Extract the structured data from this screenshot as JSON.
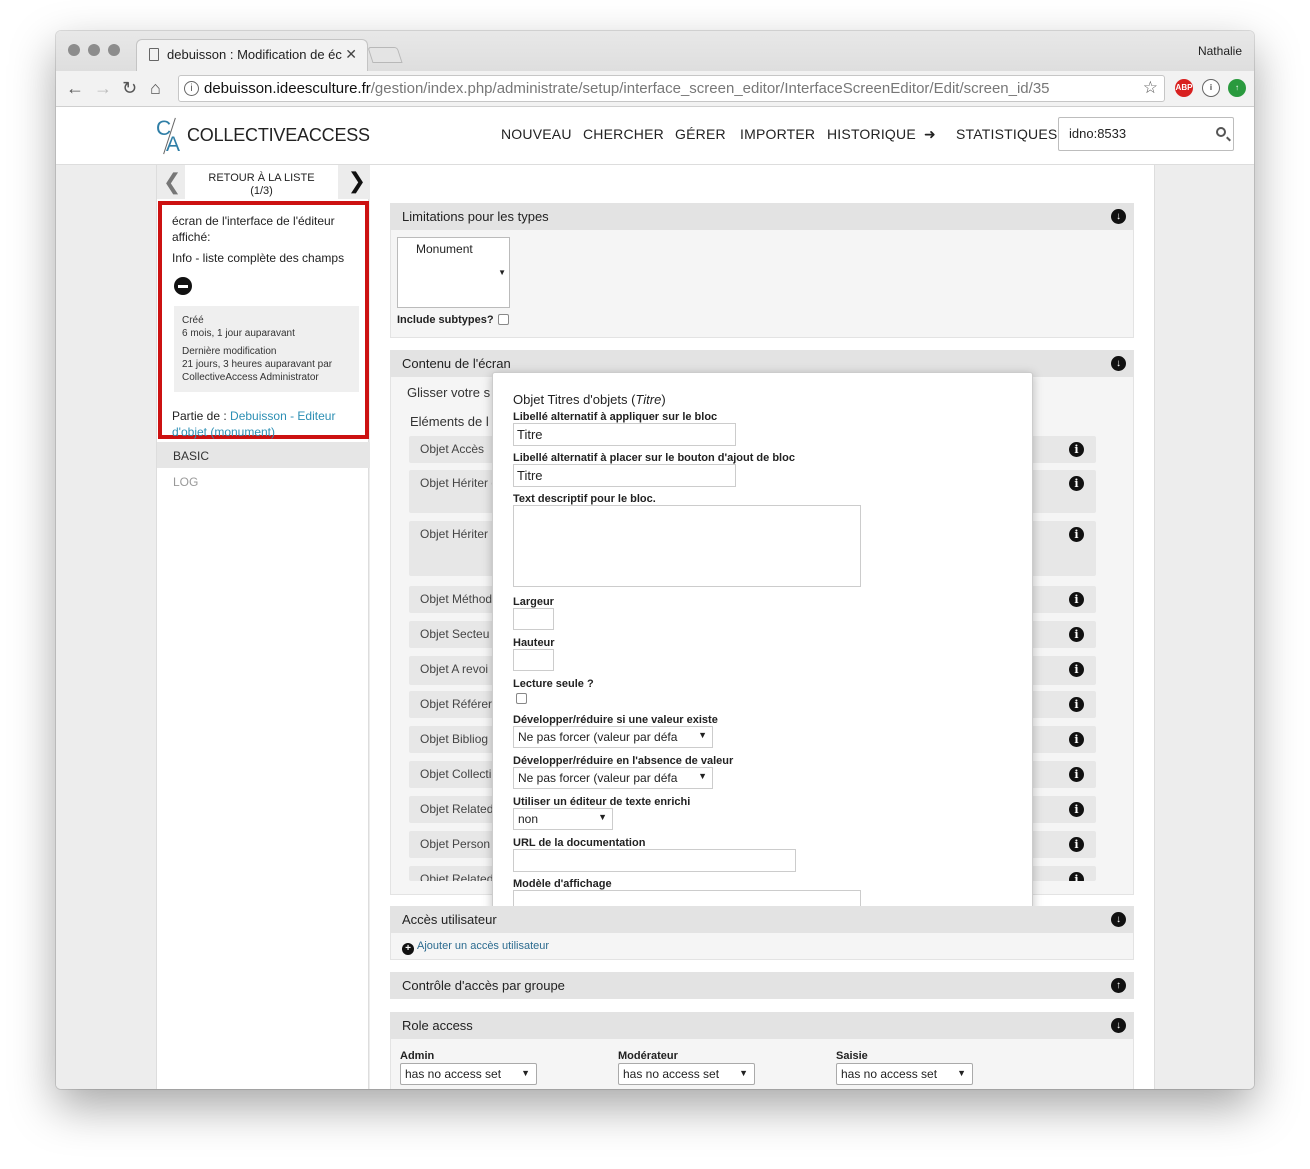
{
  "browser": {
    "tab_title": "debuisson : Modification de éc",
    "tab_close": "✕",
    "profile": "Nathalie",
    "url_host": "debuisson.ideesculture.fr",
    "url_path": "/gestion/index.php/administrate/setup/interface_screen_editor/InterfaceScreenEditor/Edit/screen_id/35",
    "ext_abp": "ABP"
  },
  "app": {
    "logo_text": "COLLECTIVEACCESS",
    "logo_c": "C",
    "logo_a": "A",
    "menu": [
      "NOUVEAU",
      "CHERCHER",
      "GÉRER",
      "IMPORTER",
      "HISTORIQUE",
      "➜",
      "STATISTIQUES"
    ],
    "search_value": "idno:8533"
  },
  "sidebar": {
    "back_label": "RETOUR À LA LISTE",
    "back_count": "(1/3)",
    "screen_label": "écran de l'interface de l'éditeur affiché:",
    "screen_name": "Info - liste complète des champs",
    "created_label": "Créé",
    "created_value": "6 mois, 1 jour auparavant",
    "modified_label": "Dernière modification",
    "modified_value": "21 jours, 3 heures auparavant par CollectiveAccess Administrator",
    "part_of_label": "Partie de :",
    "part_of_link": "Debuisson - Editeur d'objet (monument)",
    "basic": "BASIC",
    "log": "LOG"
  },
  "type_restrictions": {
    "title": "Limitations pour les types",
    "selected": "Monument",
    "include_subtypes": "Include subtypes?"
  },
  "screen_content": {
    "title": "Contenu de l'écran",
    "drag_hint": "Glisser votre s",
    "elements_label": "Eléments de l",
    "items": [
      {
        "label": "Objet Accès"
      },
      {
        "label": "Objet Hériter des collection"
      },
      {
        "label": "Objet Hériter individuel de de l'objet par"
      },
      {
        "label": "Objet Méthod"
      },
      {
        "label": "Objet Secteu"
      },
      {
        "label": "Objet A revoi"
      },
      {
        "label": "Objet Référer"
      },
      {
        "label": "Objet Bibliog"
      },
      {
        "label": "Objet Collecti"
      },
      {
        "label": "Objet Related"
      },
      {
        "label": "Objet Person"
      },
      {
        "label": "Objet Related"
      }
    ],
    "info_glyph": "i"
  },
  "popup": {
    "title_prefix": "Objet Titres d'objets (",
    "title_italic": "Titre",
    "title_suffix": ")",
    "alt_label_label": "Libellé alternatif à appliquer sur le bloc",
    "alt_label_value": "Titre",
    "add_button_label": "Libellé alternatif à placer sur le bouton d'ajout de bloc",
    "add_button_value": "Titre",
    "description_label": "Text descriptif pour le bloc.",
    "width_label": "Largeur",
    "height_label": "Hauteur",
    "readonly_label": "Lecture seule ?",
    "collapse_if_value_label": "Développer/réduire si une valeur existe",
    "collapse_if_value_value": "Ne pas forcer (valeur par défa",
    "collapse_if_empty_label": "Développer/réduire en l'absence de valeur",
    "collapse_if_empty_value": "Ne pas forcer (valeur par défa",
    "rich_text_label": "Utiliser un éditeur de texte enrichi",
    "rich_text_value": "non",
    "doc_url_label": "URL de la documentation",
    "display_template_label": "Modèle d'affichage"
  },
  "user_access": {
    "title": "Accès utilisateur",
    "add_link": "Ajouter un accès utilisateur"
  },
  "group_access": {
    "title": "Contrôle d'accès par groupe"
  },
  "role_access": {
    "title": "Role access",
    "roles": [
      {
        "name": "Admin",
        "value": "has no access set"
      },
      {
        "name": "Modérateur",
        "value": "has no access set"
      },
      {
        "name": "Saisie",
        "value": "has no access set"
      }
    ]
  },
  "icons": {
    "down": "↓",
    "up": "↑",
    "caret": "▼",
    "plus": "+"
  },
  "colors": {
    "accent": "#2c8fb4",
    "highlight_border": "#cc1111"
  }
}
